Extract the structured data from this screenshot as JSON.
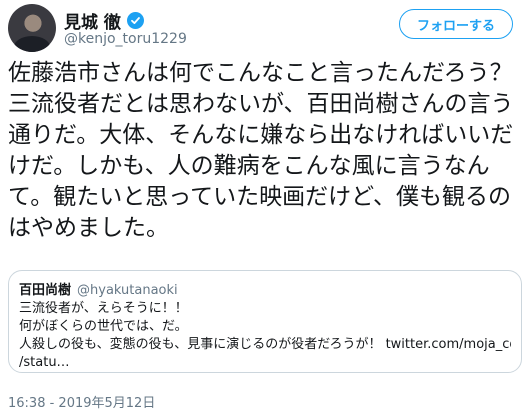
{
  "author": {
    "name": "見城 徹",
    "handle": "@kenjo_toru1229"
  },
  "follow_button": {
    "label": "フォローする"
  },
  "tweet": {
    "text": "佐藤浩市さんは何でこんなこと言ったんだろう？三流役者だとは思わないが、百田尚樹さんの言う通りだ。大体、そんなに嫌なら出なければいいだけだ。しかも、人の難病をこんな風に言うなんて。観たいと思っていた映画だけど、僕も観るのはやめました。"
  },
  "quote": {
    "name": "百田尚樹",
    "handle": "@hyakutanaoki",
    "lines": [
      "三流役者が、えらそうに！！",
      "何がぼくらの世代では、だ。",
      "人殺しの役も、変態の役も、見事に演じるのが役者だろうが！ twitter.com/moja_cos",
      "/statu…"
    ]
  },
  "timestamp": "16:38 - 2019年5月12日",
  "colors": {
    "accent": "#1da1f2",
    "muted": "#657786",
    "text": "#14171a",
    "border": "#ccd6dd"
  },
  "icons": {
    "verified": "verified-badge-icon"
  }
}
